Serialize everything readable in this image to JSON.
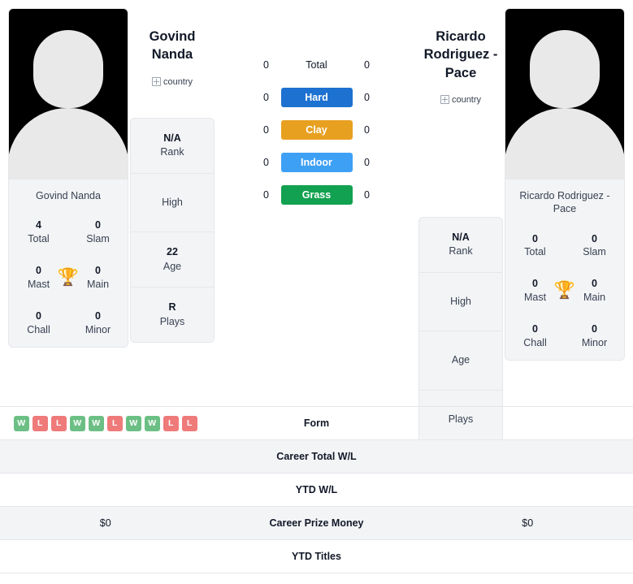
{
  "left_player": {
    "name_small": "Govind Nanda",
    "name_big_line1": "Govind",
    "name_big_line2": "Nanda",
    "flag_alt": "country",
    "stats": [
      {
        "value": "4",
        "label": "Total"
      },
      {
        "value": "0",
        "label": "Slam"
      },
      {
        "value": "0",
        "label": "Mast"
      },
      {
        "value": "0",
        "label": "Main"
      },
      {
        "value": "0",
        "label": "Chall"
      },
      {
        "value": "0",
        "label": "Minor"
      }
    ],
    "info": [
      {
        "value": "N/A",
        "label": "Rank"
      },
      {
        "value": "",
        "label": "High"
      },
      {
        "value": "22",
        "label": "Age"
      },
      {
        "value": "R",
        "label": "Plays"
      }
    ]
  },
  "right_player": {
    "name_small": "Ricardo Rodriguez - Pace",
    "name_big_line1": "Ricardo",
    "name_big_line2": "Rodriguez - Pace",
    "flag_alt": "country",
    "stats": [
      {
        "value": "0",
        "label": "Total"
      },
      {
        "value": "0",
        "label": "Slam"
      },
      {
        "value": "0",
        "label": "Mast"
      },
      {
        "value": "0",
        "label": "Main"
      },
      {
        "value": "0",
        "label": "Chall"
      },
      {
        "value": "0",
        "label": "Minor"
      }
    ],
    "info": [
      {
        "value": "N/A",
        "label": "Rank"
      },
      {
        "value": "",
        "label": "High"
      },
      {
        "value": "",
        "label": "Age"
      },
      {
        "value": "",
        "label": "Plays"
      }
    ]
  },
  "surfaces": [
    {
      "label": "Total",
      "left": "0",
      "right": "0",
      "color": "transparent"
    },
    {
      "label": "Hard",
      "left": "0",
      "right": "0",
      "color": "#1d71d0"
    },
    {
      "label": "Clay",
      "left": "0",
      "right": "0",
      "color": "#e8a020"
    },
    {
      "label": "Indoor",
      "left": "0",
      "right": "0",
      "color": "#3da0f5"
    },
    {
      "label": "Grass",
      "left": "0",
      "right": "0",
      "color": "#12a150"
    }
  ],
  "form": {
    "label": "Form",
    "results": [
      "W",
      "L",
      "L",
      "W",
      "W",
      "L",
      "W",
      "W",
      "L",
      "L"
    ],
    "win_color": "#6cbf84",
    "loss_color": "#ef7a7a"
  },
  "bottom_rows": [
    {
      "label": "Career Total W/L",
      "left": "",
      "right": ""
    },
    {
      "label": "YTD W/L",
      "left": "",
      "right": ""
    },
    {
      "label": "Career Prize Money",
      "left": "$0",
      "right": "$0"
    },
    {
      "label": "YTD Titles",
      "left": "",
      "right": ""
    }
  ],
  "icons": {
    "trophy": "🏆"
  }
}
